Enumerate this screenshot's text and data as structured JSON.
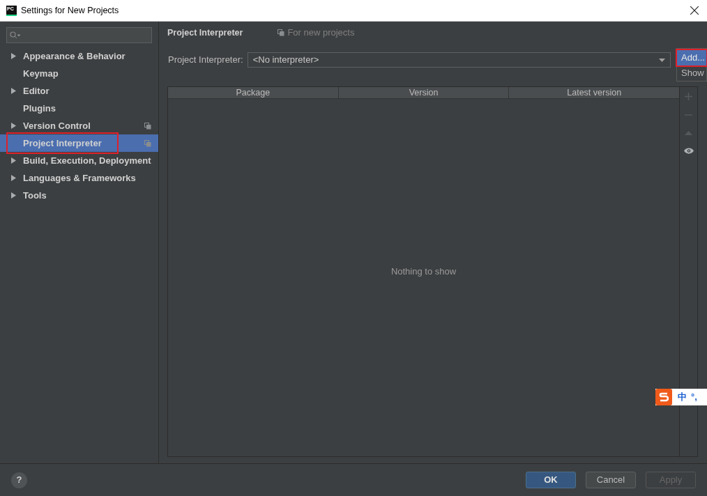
{
  "window": {
    "title": "Settings for New Projects",
    "logo": "PC"
  },
  "sidebar": {
    "items": [
      {
        "label": "Appearance & Behavior",
        "expandable": true,
        "project_scoped": false,
        "selected": false,
        "highlighted": false
      },
      {
        "label": "Keymap",
        "expandable": false,
        "project_scoped": false,
        "selected": false,
        "highlighted": false
      },
      {
        "label": "Editor",
        "expandable": true,
        "project_scoped": false,
        "selected": false,
        "highlighted": false
      },
      {
        "label": "Plugins",
        "expandable": false,
        "project_scoped": false,
        "selected": false,
        "highlighted": false
      },
      {
        "label": "Version Control",
        "expandable": true,
        "project_scoped": true,
        "selected": false,
        "highlighted": false
      },
      {
        "label": "Project Interpreter",
        "expandable": false,
        "project_scoped": true,
        "selected": true,
        "highlighted": true
      },
      {
        "label": "Build, Execution, Deployment",
        "expandable": true,
        "project_scoped": false,
        "selected": false,
        "highlighted": false
      },
      {
        "label": "Languages & Frameworks",
        "expandable": true,
        "project_scoped": false,
        "selected": false,
        "highlighted": false
      },
      {
        "label": "Tools",
        "expandable": true,
        "project_scoped": false,
        "selected": false,
        "highlighted": false
      }
    ]
  },
  "page": {
    "title": "Project Interpreter",
    "scope_note": "For new projects",
    "interpreter": {
      "label": "Project Interpreter:",
      "value": "<No interpreter>"
    },
    "menu": [
      {
        "label": "Add...",
        "selected": true,
        "highlighted": true
      },
      {
        "label": "Show",
        "selected": false,
        "highlighted": false
      }
    ],
    "table": {
      "columns": [
        "Package",
        "Version",
        "Latest version"
      ],
      "empty_text": "Nothing to show"
    },
    "toolbar": [
      {
        "kind": "plus",
        "disabled": true
      },
      {
        "kind": "minus",
        "disabled": true
      },
      {
        "kind": "up",
        "disabled": true
      },
      {
        "kind": "eye",
        "disabled": false
      }
    ]
  },
  "ime": {
    "mode": "中",
    "punct": "°,"
  },
  "footer": {
    "help": "?",
    "buttons": [
      {
        "label": "OK",
        "kind": "primary",
        "disabled": false
      },
      {
        "label": "Cancel",
        "kind": "normal",
        "disabled": false
      },
      {
        "label": "Apply",
        "kind": "normal",
        "disabled": true
      }
    ]
  }
}
